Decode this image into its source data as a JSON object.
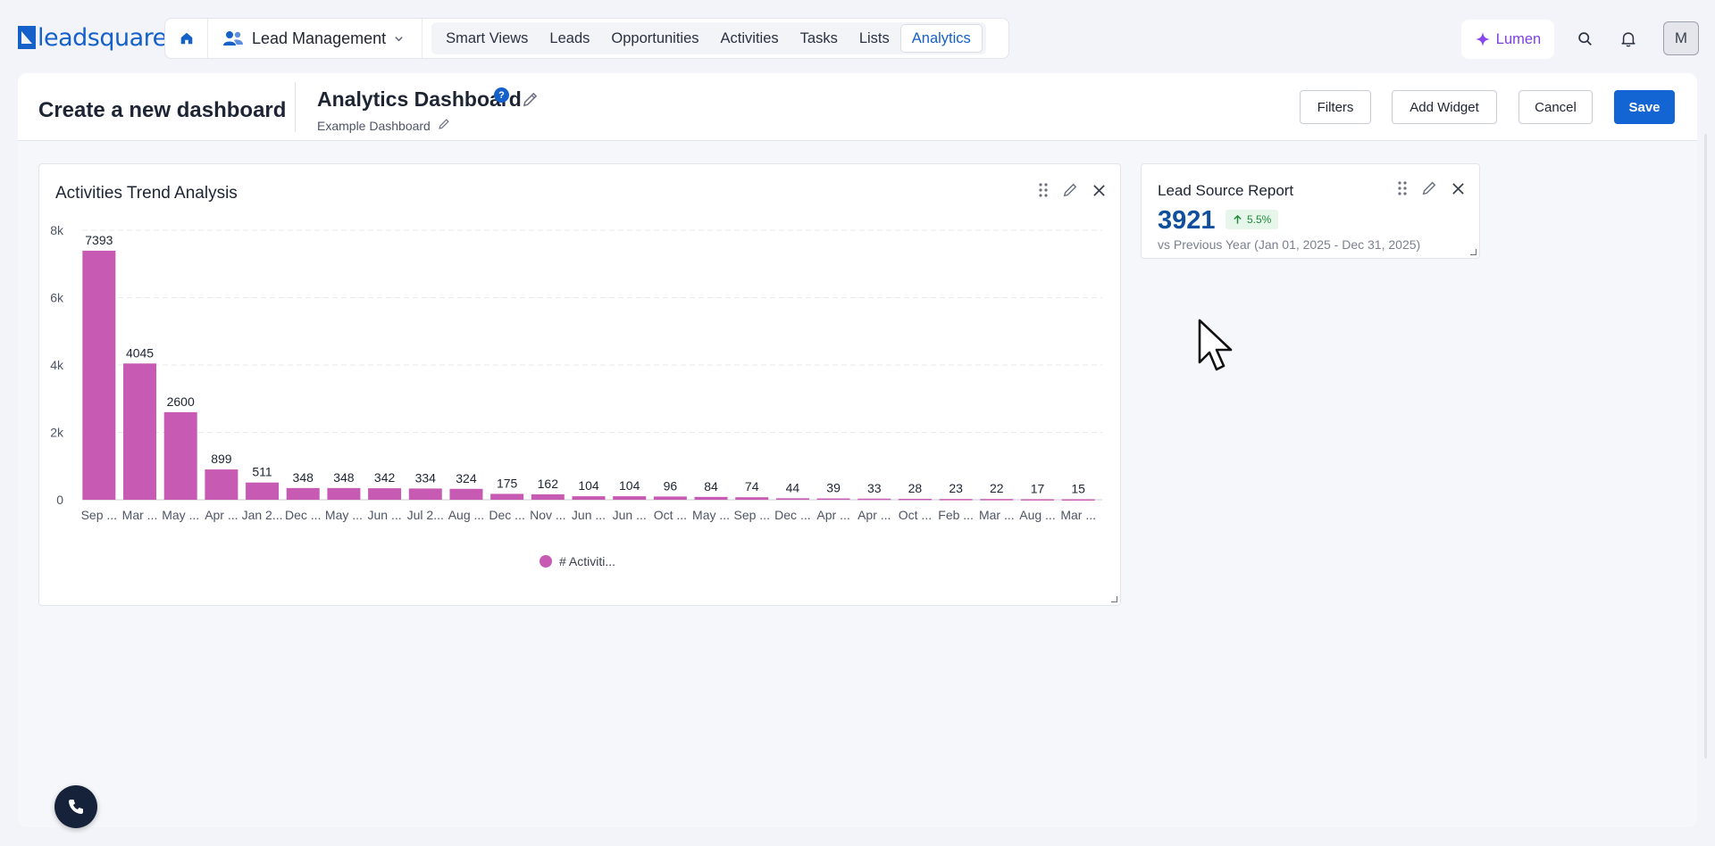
{
  "brand": {
    "logo_text": "leadsquared",
    "color": "#1560c9"
  },
  "topnav": {
    "module": "Lead Management",
    "tabs": [
      {
        "label": "Smart Views"
      },
      {
        "label": "Leads"
      },
      {
        "label": "Opportunities"
      },
      {
        "label": "Activities"
      },
      {
        "label": "Tasks"
      },
      {
        "label": "Lists"
      },
      {
        "label": "Analytics",
        "active": true
      }
    ],
    "lumen_label": "Lumen",
    "avatar_initial": "M"
  },
  "header": {
    "page_title": "Create a new dashboard",
    "dashboard_name": "Analytics Dashboard",
    "help_glyph": "?",
    "dashboard_description": "Example Dashboard",
    "buttons": {
      "filters": "Filters",
      "add_widget": "Add Widget",
      "cancel": "Cancel",
      "save": "Save"
    }
  },
  "widgets": {
    "activities": {
      "title": "Activities Trend Analysis",
      "chart_data": {
        "type": "bar",
        "categories": [
          "Sep ...",
          "Mar ...",
          "May ...",
          "Apr ...",
          "Jan 2...",
          "Dec ...",
          "May ...",
          "Jun ...",
          "Jul 2...",
          "Aug ...",
          "Dec ...",
          "Nov ...",
          "Jun ...",
          "Jun ...",
          "Oct ...",
          "May ...",
          "Sep ...",
          "Dec ...",
          "Apr ...",
          "Apr ...",
          "Oct ...",
          "Feb ...",
          "Mar ...",
          "Aug ...",
          "Mar ..."
        ],
        "values": [
          7393,
          4045,
          2600,
          899,
          511,
          348,
          348,
          342,
          334,
          324,
          175,
          162,
          104,
          104,
          96,
          84,
          74,
          44,
          39,
          33,
          28,
          23,
          22,
          17,
          15
        ],
        "y_ticks": [
          "0",
          "2k",
          "4k",
          "6k",
          "8k"
        ],
        "ylim": [
          0,
          8000
        ],
        "legend": [
          "# Activiti..."
        ],
        "color": "#c75bb3",
        "grid": true,
        "legend_position": "bottom"
      }
    },
    "lead_source": {
      "title": "Lead Source Report",
      "value": "3921",
      "change": "5.5%",
      "comparison": "vs Previous Year (Jan 01, 2025 - Dec 31, 2025)"
    }
  }
}
